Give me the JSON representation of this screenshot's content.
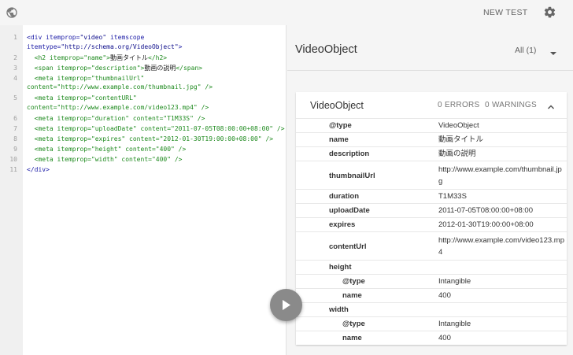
{
  "toolbar": {
    "new_test_label": "NEW TEST"
  },
  "editor": {
    "lines": [
      {
        "num": "1"
      },
      {
        "num": ""
      },
      {
        "num": "2"
      },
      {
        "num": "3"
      },
      {
        "num": "4"
      },
      {
        "num": ""
      },
      {
        "num": "5"
      },
      {
        "num": ""
      },
      {
        "num": "6"
      },
      {
        "num": "7"
      },
      {
        "num": "8"
      },
      {
        "num": "9"
      },
      {
        "num": "10"
      },
      {
        "num": "11"
      }
    ],
    "code": {
      "l1_tag": "<div ",
      "l1_a1": "itemprop=",
      "l1_v1": "\"video\"",
      "l1_a2": " itemscope",
      "l1b_a": "itemtype=",
      "l1b_v": "\"http://schema.org/VideoObject\"",
      "l1b_close": ">",
      "l2_open": "<h2 ",
      "l2_a": "itemprop=",
      "l2_v": "\"name\"",
      "l2_gt": ">",
      "l2_text": "動画タイトル",
      "l2_close": "</h2>",
      "l3_open": "<span ",
      "l3_a": "itemprop=",
      "l3_v": "\"description\"",
      "l3_gt": ">",
      "l3_text": "動画の説明",
      "l3_close": "</span>",
      "l4_open": "<meta ",
      "l4_a": "itemprop=",
      "l4_v": "\"thumbnailUrl\"",
      "l4b_a": "content=",
      "l4b_v": "\"http://www.example.com/thumbnail.jpg\"",
      "l4b_close": " />",
      "l5_open": "<meta ",
      "l5_a": "itemprop=",
      "l5_v": "\"contentURL\"",
      "l5b_a": "content=",
      "l5b_v": "\"http://www.example.com/video123.mp4\"",
      "l5b_close": " />",
      "l6_text": "<meta itemprop=\"duration\" content=\"T1M33S\" />",
      "l7_text": "<meta itemprop=\"uploadDate\" content=\"2011-07-05T08:00:00+08:00\" />",
      "l8_text": "<meta itemprop=\"expires\" content=\"2012-01-30T19:00:00+08:00\" />",
      "l9_text": "<meta itemprop=\"height\" content=\"400\" />",
      "l10_text": "<meta itemprop=\"width\" content=\"400\" />",
      "l11_text": "</div>"
    }
  },
  "results": {
    "title": "VideoObject",
    "filter_label": "All (1)",
    "card": {
      "title": "VideoObject",
      "errors": "0 ERRORS",
      "warnings": "0 WARNINGS",
      "rows": [
        {
          "key": "@type",
          "value": "VideoObject"
        },
        {
          "key": "name",
          "value": "動画タイトル"
        },
        {
          "key": "description",
          "value": "動画の説明"
        },
        {
          "key": "thumbnailUrl",
          "value": "http://www.example.com/thumbnail.jpg"
        },
        {
          "key": "duration",
          "value": "T1M33S"
        },
        {
          "key": "uploadDate",
          "value": "2011-07-05T08:00:00+08:00"
        },
        {
          "key": "expires",
          "value": "2012-01-30T19:00:00+08:00"
        },
        {
          "key": "contentUrl",
          "value": "http://www.example.com/video123.mp4"
        },
        {
          "key": "height",
          "value": ""
        },
        {
          "key": "@type",
          "value": "Intangible"
        },
        {
          "key": "name",
          "value": "400"
        },
        {
          "key": "width",
          "value": ""
        },
        {
          "key": "@type",
          "value": "Intangible"
        },
        {
          "key": "name",
          "value": "400"
        }
      ]
    }
  },
  "colors": {
    "accent": "#9e9e9e",
    "tag": "#1a1aa6",
    "comment_green": "#1e8a1e"
  }
}
